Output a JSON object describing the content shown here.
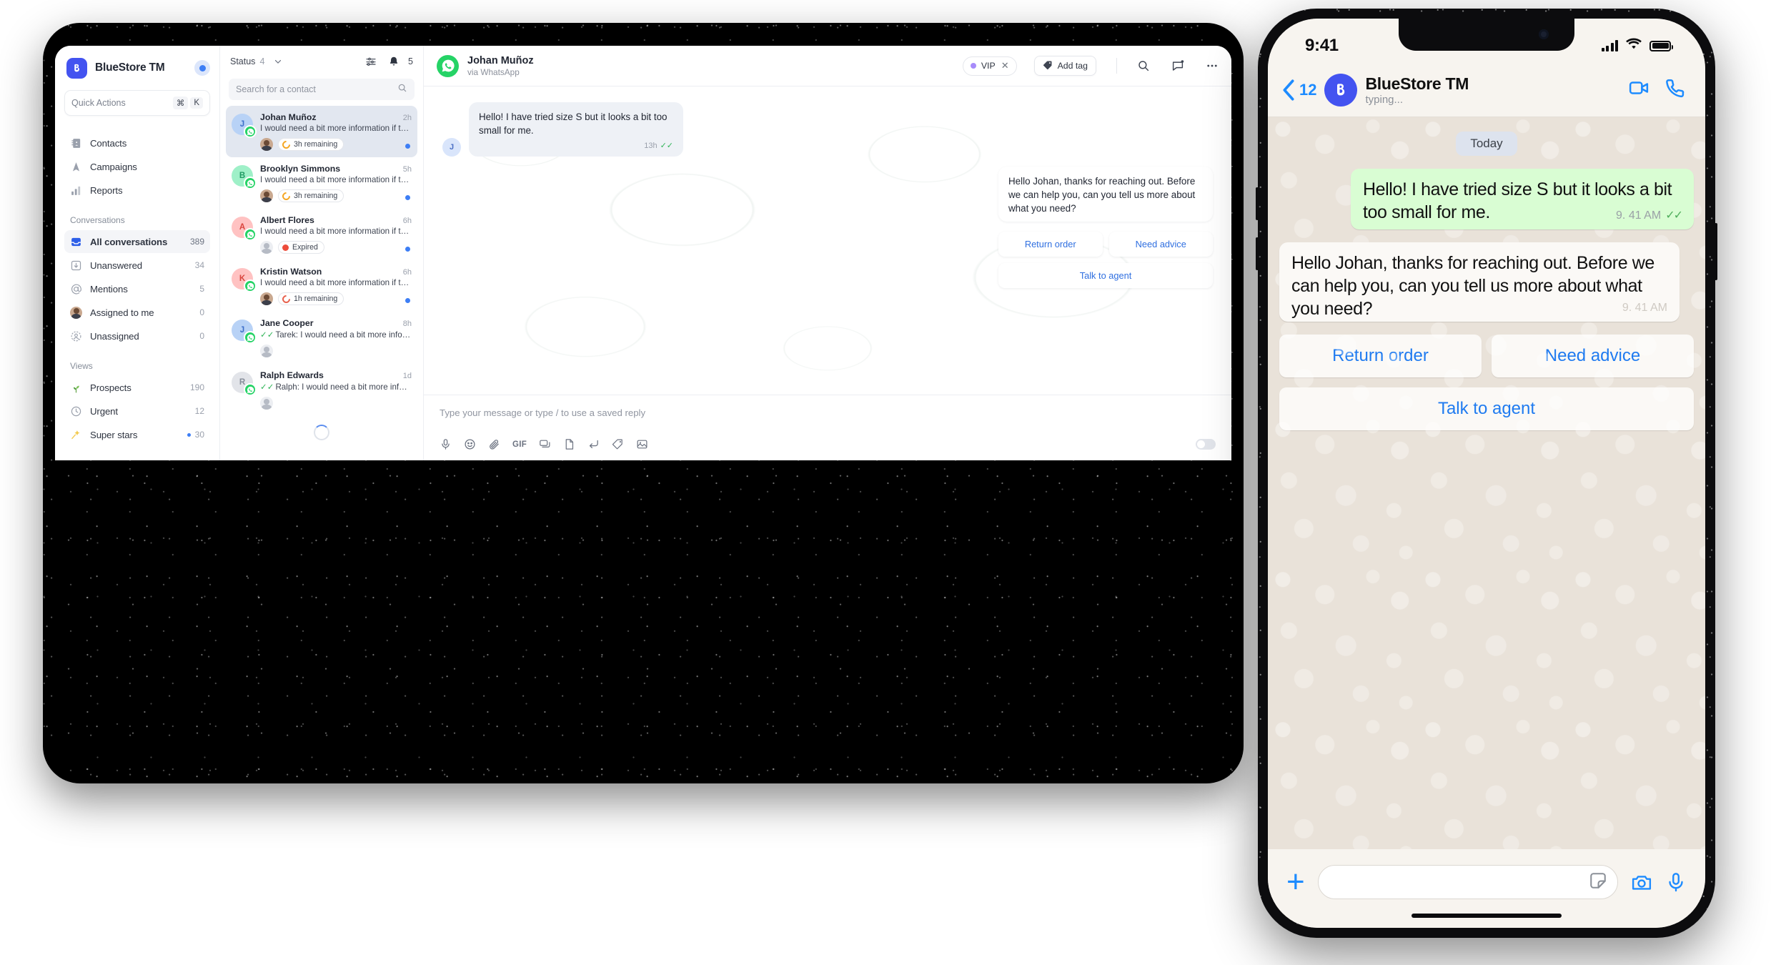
{
  "desktop": {
    "sidebar": {
      "brand": {
        "name": "BlueStore TM",
        "logo_icon": "bluestore-logo-icon",
        "status_dot_color": "#3d7ef5"
      },
      "quick_actions": {
        "label": "Quick Actions",
        "shortcut_cmd": "⌘",
        "shortcut_key": "K"
      },
      "primary_items": [
        {
          "label": "Contacts",
          "icon": "contacts-book-icon"
        },
        {
          "label": "Campaigns",
          "icon": "campaigns-arrow-icon"
        },
        {
          "label": "Reports",
          "icon": "reports-bars-icon"
        }
      ],
      "conversations_section": {
        "title": "Conversations"
      },
      "conversation_items": [
        {
          "label": "All conversations",
          "count": "389",
          "icon": "inbox-icon",
          "active": true
        },
        {
          "label": "Unanswered",
          "count": "34",
          "icon": "arrow-down-box-icon",
          "active": false
        },
        {
          "label": "Mentions",
          "count": "5",
          "icon": "at-sign-icon",
          "active": false
        },
        {
          "label": "Assigned to me",
          "count": "0",
          "icon": "avatar-icon",
          "active": false
        },
        {
          "label": "Unassigned",
          "count": "0",
          "icon": "user-dashed-icon",
          "active": false
        }
      ],
      "views_section": {
        "title": "Views"
      },
      "view_items": [
        {
          "label": "Prospects",
          "count": "190",
          "icon": "seedling-icon",
          "dot": false
        },
        {
          "label": "Urgent",
          "count": "12",
          "icon": "clock-icon",
          "dot": false
        },
        {
          "label": "Super stars",
          "count": "30",
          "icon": "shooting-star-icon",
          "dot": true
        }
      ]
    },
    "conv_list": {
      "status_label": "Status",
      "status_count": "4",
      "chevron_icon": "chevron-down-icon",
      "filter_icon": "filter-sliders-icon",
      "bell_icon": "bell-icon",
      "bell_count": "5",
      "search_placeholder": "Search for a contact",
      "search_icon": "search-icon",
      "items": [
        {
          "name": "Johan Muñoz",
          "time": "2h",
          "preview": "I would need a bit more information if that's…",
          "initial": "J",
          "avatar_bg": "#b8d2f6",
          "avatar_fg": "#3d6fc9",
          "channel_icon": "whatsapp-icon",
          "chip_label": "3h remaining",
          "chip_kind": "ring-orange",
          "has_agent_avatar": true,
          "unread": true,
          "selected": true
        },
        {
          "name": "Brooklyn Simmons",
          "time": "5h",
          "preview": "I would need a bit more information if that's…",
          "initial": "B",
          "avatar_bg": "#9ff0c8",
          "avatar_fg": "#1f9a63",
          "channel_icon": "whatsapp-icon",
          "chip_label": "3h remaining",
          "chip_kind": "ring-orange",
          "has_agent_avatar": true,
          "unread": true,
          "selected": false
        },
        {
          "name": "Albert Flores",
          "time": "6h",
          "preview": "I would need a bit more information if that's…",
          "initial": "A",
          "avatar_bg": "#ffc2c2",
          "avatar_fg": "#d9453e",
          "channel_icon": "whatsapp-icon",
          "chip_label": "Expired",
          "chip_kind": "dot-red",
          "has_agent_avatar": false,
          "unread": true,
          "selected": false
        },
        {
          "name": "Kristin Watson",
          "time": "6h",
          "preview": "I would need a bit more information if that's…",
          "initial": "K",
          "avatar_bg": "#ffc2c2",
          "avatar_fg": "#d9453e",
          "channel_icon": "whatsapp-icon",
          "chip_label": "1h remaining",
          "chip_kind": "ring-red",
          "has_agent_avatar": true,
          "unread": true,
          "selected": false
        },
        {
          "name": "Jane Cooper",
          "time": "8h",
          "preview": "Tarek: I would need a bit more information…",
          "preview_has_tick": true,
          "initial": "J",
          "avatar_bg": "#b8d2f6",
          "avatar_fg": "#3d6fc9",
          "channel_icon": "whatsapp-icon",
          "chip_label": "",
          "chip_kind": "none",
          "has_agent_avatar": false,
          "unread": false,
          "selected": false
        },
        {
          "name": "Ralph Edwards",
          "time": "1d",
          "preview": "Ralph: I would need a bit more information…",
          "preview_has_tick": true,
          "initial": "R",
          "avatar_bg": "#e2e4e9",
          "avatar_fg": "#868d99",
          "channel_icon": "whatsapp-icon",
          "chip_label": "",
          "chip_kind": "none",
          "has_agent_avatar": false,
          "unread": false,
          "selected": false
        }
      ],
      "loading_spinner": true
    },
    "chat": {
      "contact_name": "Johan Muñoz",
      "channel_sub": "via WhatsApp",
      "channel_icon": "whatsapp-icon",
      "tag": {
        "label": "VIP",
        "dot_color": "#a78bfa",
        "close_icon": "close-icon"
      },
      "add_tag_button": {
        "label": "Add tag",
        "icon": "tag-icon"
      },
      "header_icons": [
        "search-icon",
        "note-icon"
      ],
      "messages": [
        {
          "direction": "in",
          "avatar_initial": "J",
          "text": "Hello! I have tried size S but it looks a bit too small for me.",
          "time": "13h",
          "ticks": true
        },
        {
          "direction": "out",
          "text": "Hello Johan, thanks for reaching out. Before we can help you, can you tell us more about what you need?",
          "time": "",
          "ticks": false
        }
      ],
      "quick_replies": [
        "Return order",
        "Need advice",
        "Talk to agent"
      ],
      "composer": {
        "placeholder": "Type your message or type / to use a saved reply",
        "tool_icons": [
          "mic-icon",
          "emoji-icon",
          "attachment-icon",
          "gif-icon",
          "canned-reply-icon",
          "document-icon",
          "return-icon",
          "tag-icon",
          "image-icon"
        ],
        "toggle_on": false
      }
    }
  },
  "phone": {
    "status_bar": {
      "time": "9:41",
      "signal_icon": "signal-bars-icon",
      "wifi_icon": "wifi-icon",
      "battery_icon": "battery-icon"
    },
    "header": {
      "back_icon": "chevron-left-icon",
      "back_count": "12",
      "avatar_icon": "bluestore-logo-icon",
      "title": "BlueStore TM",
      "subtitle": "typing...",
      "video_icon": "video-camera-icon",
      "call_icon": "phone-icon"
    },
    "day_divider": "Today",
    "messages": [
      {
        "direction": "out",
        "text": "Hello! I have tried size S but it looks a bit too small for me.",
        "time": "9. 41 AM",
        "ticks": true
      },
      {
        "direction": "in",
        "text": "Hello Johan, thanks for reaching out. Before we can help you, can you tell us more about what you need?",
        "time": "9. 41 AM",
        "ticks": false
      }
    ],
    "quick_replies_row1": [
      "Return order",
      "Need advice"
    ],
    "quick_replies_row2": [
      "Talk to agent"
    ],
    "footer": {
      "plus_icon": "plus-icon",
      "input_placeholder": "",
      "sticker_icon": "sticker-icon",
      "camera_icon": "camera-icon",
      "mic_icon": "mic-icon"
    }
  }
}
